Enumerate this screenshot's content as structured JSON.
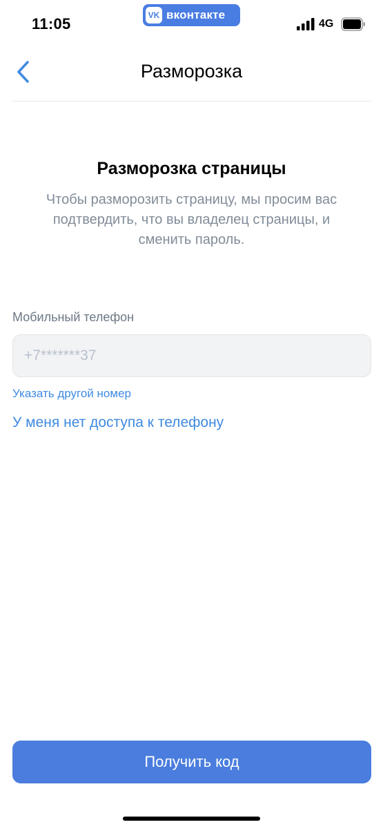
{
  "status_bar": {
    "time": "11:05",
    "app_badge": "вконтакте",
    "app_logo": "VK",
    "network": "4G",
    "icons": [
      "signal-icon",
      "battery-icon"
    ]
  },
  "nav": {
    "title": "Разморозка",
    "back_icon": "chevron-left-icon"
  },
  "content": {
    "heading": "Разморозка страницы",
    "description": "Чтобы разморозить страницу, мы просим вас подтвердить, что вы владелец страницы, и сменить пароль.",
    "phone_field": {
      "label": "Мобильный телефон",
      "placeholder": "+7*******37"
    },
    "alt_number_link": "Указать другой номер",
    "no_access_link": "У меня нет доступа к телефону"
  },
  "footer": {
    "button_label": "Получить код"
  },
  "colors": {
    "accent": "#3f8ae0",
    "button": "#4a7ddd",
    "secondary_text": "#818c99"
  }
}
